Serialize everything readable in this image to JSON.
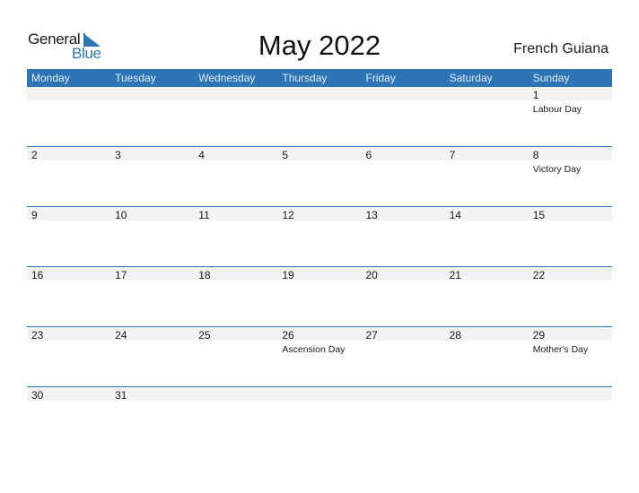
{
  "logo": {
    "word1": "General",
    "word2": "Blue",
    "icon": "triangle-flag-icon"
  },
  "title": "May 2022",
  "country": "French Guiana",
  "colors": {
    "accent": "#2e75b6",
    "band": "#f2f2f2"
  },
  "weekdays": [
    "Monday",
    "Tuesday",
    "Wednesday",
    "Thursday",
    "Friday",
    "Saturday",
    "Sunday"
  ],
  "weeks": [
    {
      "days": [
        {
          "num": "",
          "holiday": ""
        },
        {
          "num": "",
          "holiday": ""
        },
        {
          "num": "",
          "holiday": ""
        },
        {
          "num": "",
          "holiday": ""
        },
        {
          "num": "",
          "holiday": ""
        },
        {
          "num": "",
          "holiday": ""
        },
        {
          "num": "1",
          "holiday": "Labour Day"
        }
      ]
    },
    {
      "days": [
        {
          "num": "2",
          "holiday": ""
        },
        {
          "num": "3",
          "holiday": ""
        },
        {
          "num": "4",
          "holiday": ""
        },
        {
          "num": "5",
          "holiday": ""
        },
        {
          "num": "6",
          "holiday": ""
        },
        {
          "num": "7",
          "holiday": ""
        },
        {
          "num": "8",
          "holiday": "Victory Day"
        }
      ]
    },
    {
      "days": [
        {
          "num": "9",
          "holiday": ""
        },
        {
          "num": "10",
          "holiday": ""
        },
        {
          "num": "11",
          "holiday": ""
        },
        {
          "num": "12",
          "holiday": ""
        },
        {
          "num": "13",
          "holiday": ""
        },
        {
          "num": "14",
          "holiday": ""
        },
        {
          "num": "15",
          "holiday": ""
        }
      ]
    },
    {
      "days": [
        {
          "num": "16",
          "holiday": ""
        },
        {
          "num": "17",
          "holiday": ""
        },
        {
          "num": "18",
          "holiday": ""
        },
        {
          "num": "19",
          "holiday": ""
        },
        {
          "num": "20",
          "holiday": ""
        },
        {
          "num": "21",
          "holiday": ""
        },
        {
          "num": "22",
          "holiday": ""
        }
      ]
    },
    {
      "days": [
        {
          "num": "23",
          "holiday": ""
        },
        {
          "num": "24",
          "holiday": ""
        },
        {
          "num": "25",
          "holiday": ""
        },
        {
          "num": "26",
          "holiday": "Ascension Day"
        },
        {
          "num": "27",
          "holiday": ""
        },
        {
          "num": "28",
          "holiday": ""
        },
        {
          "num": "29",
          "holiday": "Mother's Day"
        }
      ]
    },
    {
      "days": [
        {
          "num": "30",
          "holiday": ""
        },
        {
          "num": "31",
          "holiday": ""
        },
        {
          "num": "",
          "holiday": ""
        },
        {
          "num": "",
          "holiday": ""
        },
        {
          "num": "",
          "holiday": ""
        },
        {
          "num": "",
          "holiday": ""
        },
        {
          "num": "",
          "holiday": ""
        }
      ]
    }
  ]
}
